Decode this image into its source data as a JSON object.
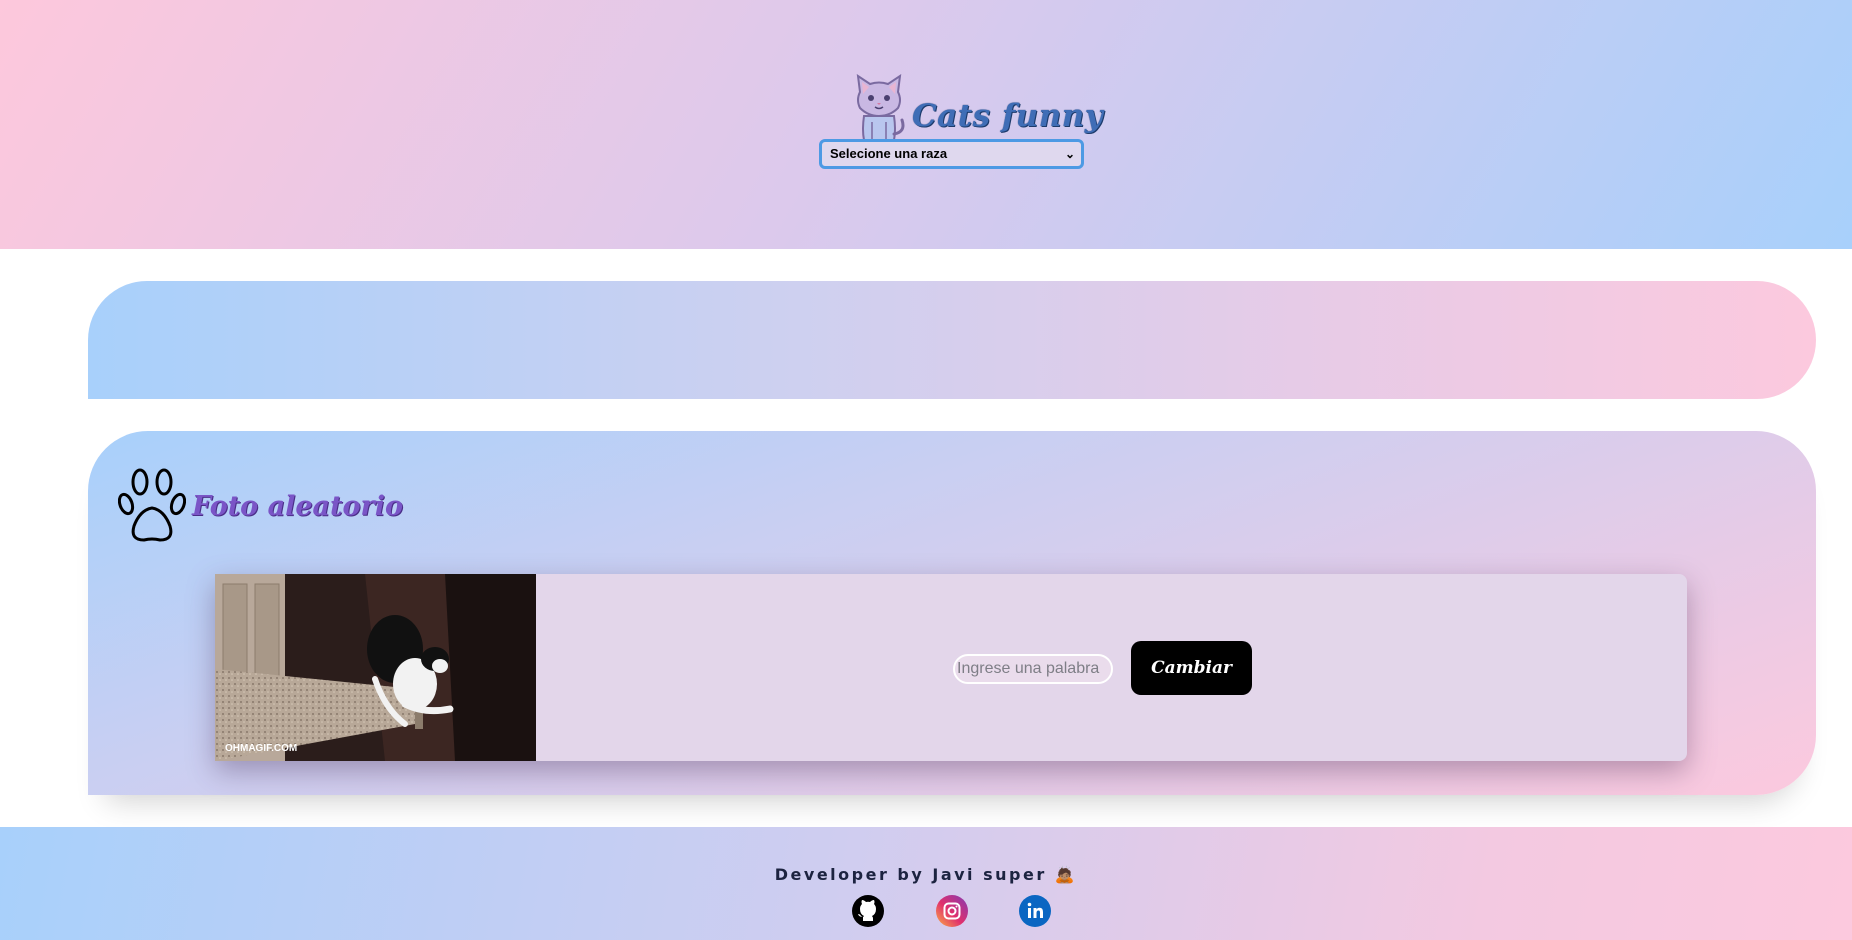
{
  "header": {
    "app_title": "Cats funny",
    "logo_icon": "cat-icon",
    "breed_select": {
      "selected": "Selecione una raza"
    }
  },
  "random_photo": {
    "title": "Foto aleatorio",
    "title_icon": "paw-icon",
    "image_watermark": "OHMAGIF.COM",
    "word_input": {
      "placeholder": "Ingrese una palabra",
      "value": ""
    },
    "change_button_label": "Cambiar"
  },
  "footer": {
    "credit": "Developer by Javi super 🙇🏽",
    "social_links": [
      {
        "icon": "github-icon"
      },
      {
        "icon": "instagram-icon"
      },
      {
        "icon": "linkedin-icon"
      }
    ]
  },
  "colors": {
    "select_border": "#4d9ae4",
    "button_bg": "#000000",
    "section_title": "#7a55c7",
    "brand_title": "#3f6db6"
  }
}
